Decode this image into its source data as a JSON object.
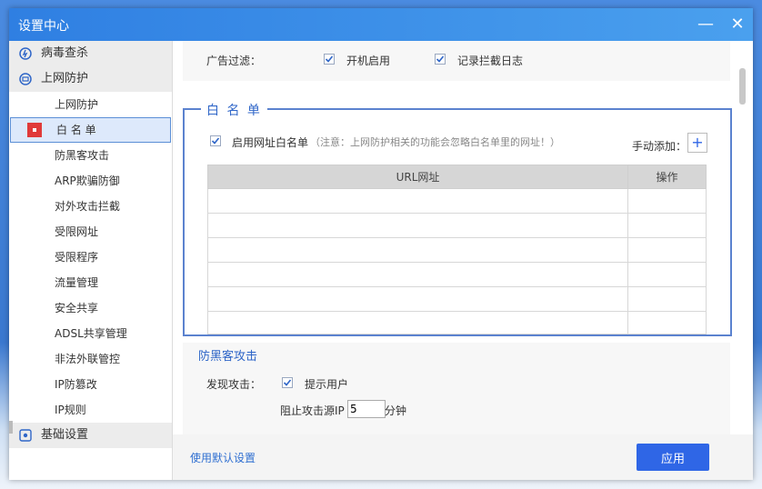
{
  "window": {
    "title": "设置中心",
    "minimize": "—",
    "close": "✕"
  },
  "sidebar": {
    "categories": [
      {
        "label": "病毒查杀",
        "icon": "virus-scan-icon"
      },
      {
        "label": "上网防护",
        "icon": "network-protection-icon"
      }
    ],
    "items": [
      "上网防护",
      "白 名 单",
      "防黑客攻击",
      "ARP欺骗防御",
      "对外攻击拦截",
      "受限网址",
      "受限程序",
      "流量管理",
      "安全共享",
      "ADSL共享管理",
      "非法外联管控",
      "IP防篡改",
      "IP规则"
    ],
    "active_index": 1,
    "bottom_category": {
      "label": "基础设置",
      "icon": "gear-icon"
    }
  },
  "ad_filter": {
    "label": "广告过滤：",
    "opt1": "开机启用",
    "opt2": "记录拦截日志"
  },
  "whitelist": {
    "title": "白 名 单",
    "enable_label": "启用网址白名单",
    "note": "（注意：上网防护相关的功能会忽略白名单里的网址！）",
    "manual_add": "手动添加：",
    "col_url": "URL网址",
    "col_action": "操作"
  },
  "antihack": {
    "title": "防黑客攻击",
    "detect_label": "发现攻击：",
    "notify_label": "提示用户",
    "block_label": "阻止攻击源IP",
    "minutes_value": "5",
    "minutes_unit": "分钟"
  },
  "footer": {
    "default_link": "使用默认设置",
    "apply": "应用"
  },
  "colors": {
    "accent": "#2f66e6",
    "title_bar": "#3a8ae8"
  }
}
